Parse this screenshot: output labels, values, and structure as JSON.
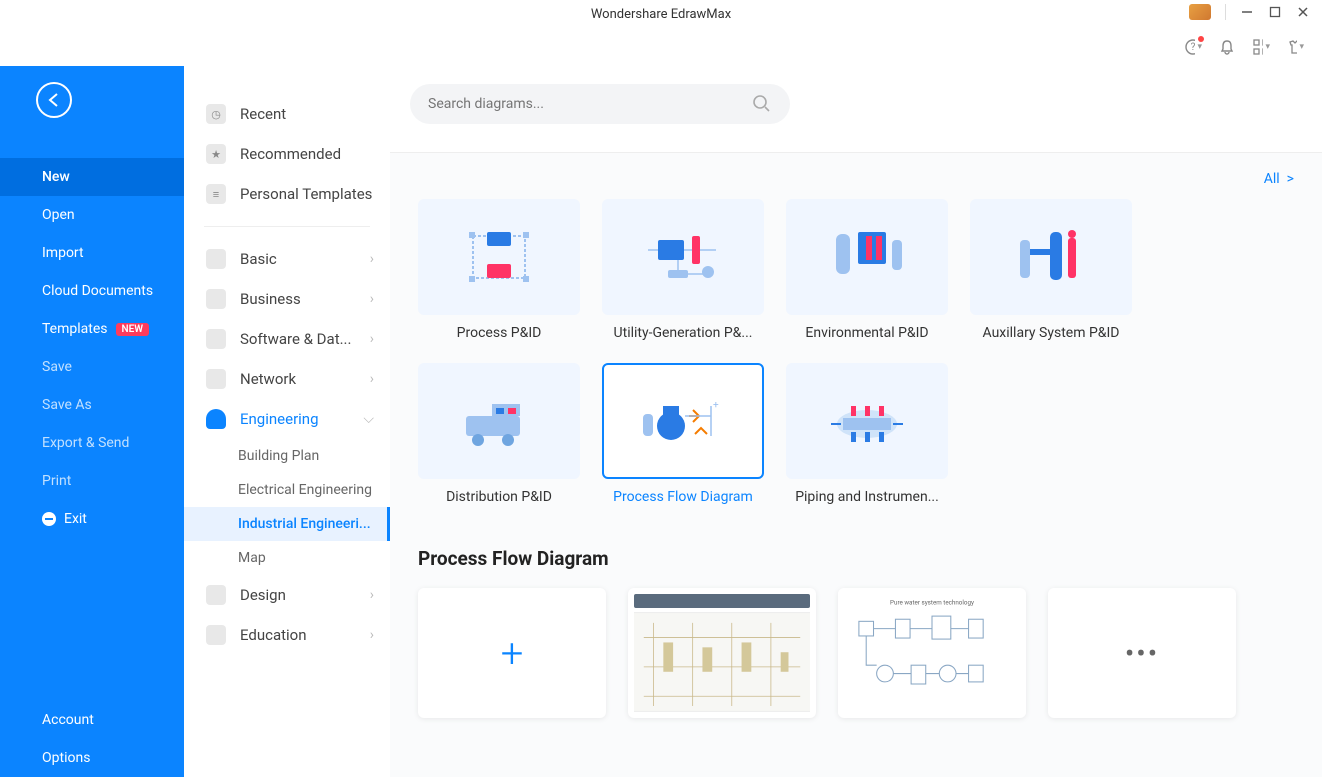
{
  "title": "Wondershare EdrawMax",
  "search": {
    "placeholder": "Search diagrams..."
  },
  "nav": {
    "items": [
      {
        "label": "New",
        "active": true
      },
      {
        "label": "Open"
      },
      {
        "label": "Import"
      },
      {
        "label": "Cloud Documents"
      },
      {
        "label": "Templates",
        "badge": "NEW"
      },
      {
        "label": "Save",
        "dim": true
      },
      {
        "label": "Save As",
        "dim": true
      },
      {
        "label": "Export & Send",
        "dim": true
      },
      {
        "label": "Print",
        "dim": true
      },
      {
        "label": "Exit",
        "icon": true
      }
    ],
    "footer": [
      {
        "label": "Account"
      },
      {
        "label": "Options"
      }
    ]
  },
  "categories": {
    "top": [
      {
        "label": "Recent"
      },
      {
        "label": "Recommended"
      },
      {
        "label": "Personal Templates"
      }
    ],
    "main": [
      {
        "label": "Basic"
      },
      {
        "label": "Business"
      },
      {
        "label": "Software & Dat..."
      },
      {
        "label": "Network"
      },
      {
        "label": "Engineering",
        "selected": true,
        "expanded": true,
        "subs": [
          {
            "label": "Building Plan"
          },
          {
            "label": "Electrical Engineering"
          },
          {
            "label": "Industrial Engineeri...",
            "selected": true
          },
          {
            "label": "Map"
          }
        ]
      },
      {
        "label": "Design"
      },
      {
        "label": "Education"
      }
    ]
  },
  "allLink": "All",
  "tiles": [
    {
      "label": "Process P&ID"
    },
    {
      "label": "Utility-Generation P&..."
    },
    {
      "label": "Environmental P&ID"
    },
    {
      "label": "Auxillary System P&ID"
    },
    {
      "label": "Distribution P&ID"
    },
    {
      "label": "Process Flow Diagram",
      "selected": true
    },
    {
      "label": "Piping and Instrumen..."
    }
  ],
  "sectionTitle": "Process Flow Diagram"
}
